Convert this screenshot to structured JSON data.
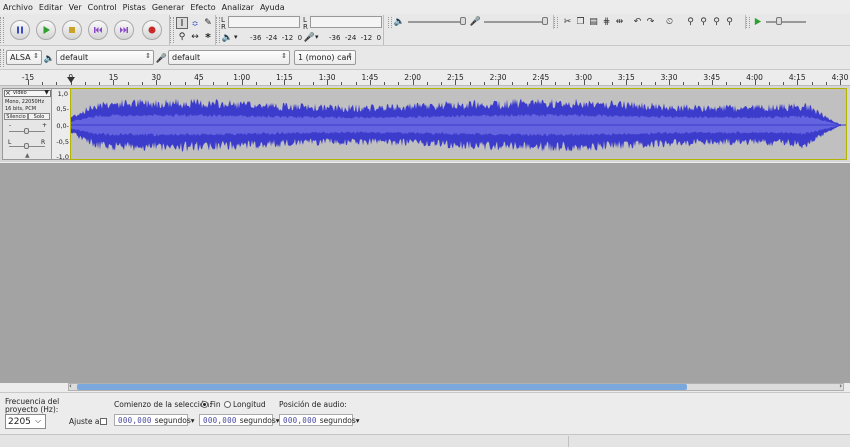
{
  "menu": [
    "Archivo",
    "Editar",
    "Ver",
    "Control",
    "Pistas",
    "Generar",
    "Efecto",
    "Analizar",
    "Ayuda"
  ],
  "meters": {
    "record_letters": [
      "L",
      "R"
    ],
    "play_letters": [
      "L",
      "R"
    ],
    "record_scale": [
      "-36",
      "-24",
      "-12",
      "0"
    ],
    "play_scale": [
      "-36",
      "-24",
      "-12",
      "0"
    ]
  },
  "device": {
    "host": "ALSA",
    "playback": "default",
    "recording": "default",
    "channels": "1 (mono) can"
  },
  "ruler": [
    "-15",
    "0",
    "15",
    "30",
    "45",
    "1:00",
    "1:15",
    "1:30",
    "1:45",
    "2:00",
    "2:15",
    "2:30",
    "2:45",
    "3:00",
    "3:15",
    "3:30",
    "3:45",
    "4:00",
    "4:15",
    "4:30"
  ],
  "track": {
    "name": "video",
    "info_line1": "Mono, 22050Hz",
    "info_line2": "16 bits, PCM",
    "mute": "Silencio",
    "solo": "Solo",
    "gain_minus": "-",
    "gain_plus": "+",
    "pan_left": "L",
    "pan_right": "R",
    "scale": [
      "1,0",
      "0,5-",
      "0,0-",
      "-0,5",
      "-1,0"
    ],
    "wave_color": "#3c3ccc",
    "wave_rms_color": "#6464e0"
  },
  "selection": {
    "rate_label_1": "Frecuencia del",
    "rate_label_2": "proyecto (Hz):",
    "rate_value": "2205",
    "snap_label": "Ajuste a",
    "start_label": "Comienzo de la selección:",
    "end_option": "Fin",
    "length_option": "Longitud",
    "audio_pos_label": "Posición de audio:",
    "time1": "000,000",
    "time2": "000,000",
    "time3": "000,000",
    "unit": "segundos"
  }
}
